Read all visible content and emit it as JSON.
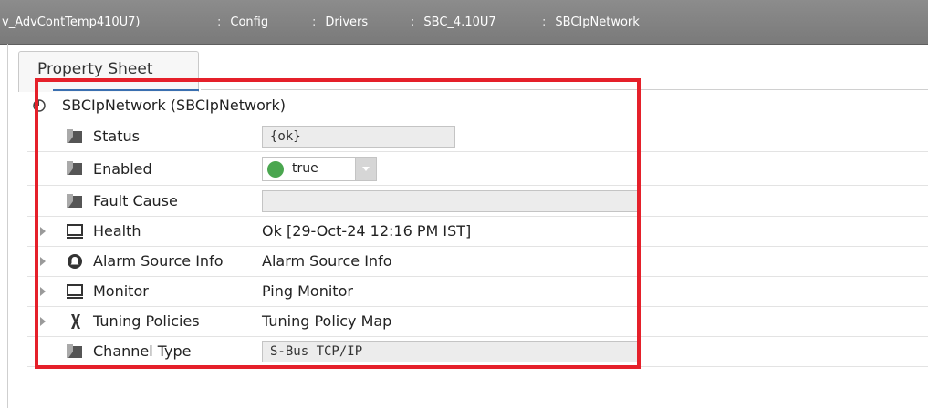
{
  "breadcrumb": {
    "items": [
      "v_AdvContTemp410U7)",
      "Config",
      "Drivers",
      "SBC_4.10U7",
      "SBCIpNetwork"
    ],
    "separator": ":"
  },
  "tab": {
    "label": "Property Sheet"
  },
  "root": {
    "label": "SBCIpNetwork  (SBCIpNetwork)"
  },
  "properties": [
    {
      "name": "Status",
      "value": "{ok}",
      "icon": "slot-icon"
    },
    {
      "name": "Enabled",
      "value": "true",
      "icon": "slot-icon"
    },
    {
      "name": "Fault Cause",
      "value": "",
      "icon": "slot-icon"
    },
    {
      "name": "Health",
      "value": "Ok [29-Oct-24 12:16 PM IST]",
      "icon": "monitor-icon"
    },
    {
      "name": "Alarm Source Info",
      "value": "Alarm Source Info",
      "icon": "alarm-icon"
    },
    {
      "name": "Monitor",
      "value": "Ping Monitor",
      "icon": "monitor-icon"
    },
    {
      "name": "Tuning Policies",
      "value": "Tuning Policy Map",
      "icon": "tuning-icon"
    },
    {
      "name": "Channel Type",
      "value": "S-Bus TCP/IP",
      "icon": "slot-icon"
    }
  ],
  "colors": {
    "highlight": "#e5202a",
    "enabled_dot": "#4aa64f"
  }
}
